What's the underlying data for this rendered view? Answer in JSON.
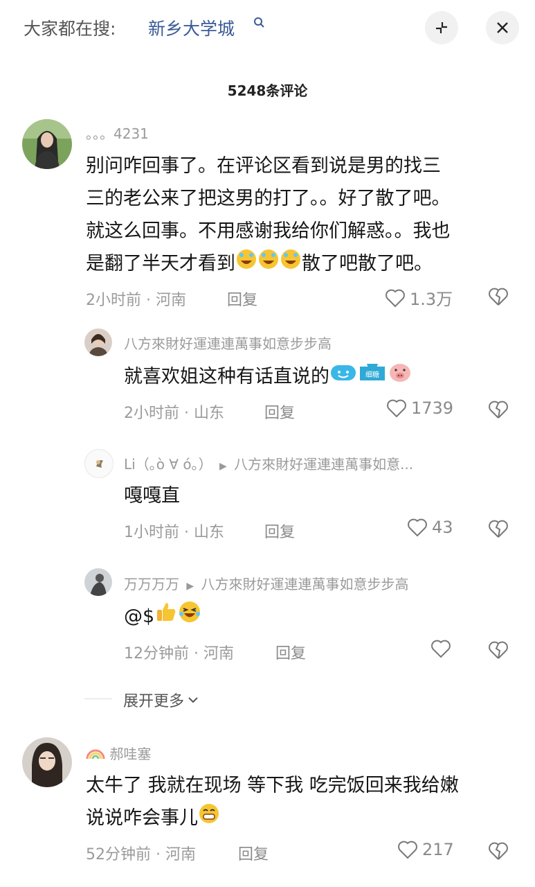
{
  "search": {
    "prefix": "大家都在搜:",
    "term": "新乡大学城"
  },
  "comment_count_title": "5248条评论",
  "comments": [
    {
      "username": "。。。4231",
      "text_lines": [
        "别问咋回事了。在评论区看到说是男的找三",
        "三的老公来了把这男的打了。。好了散了吧。",
        "就这么回事。不用感谢我给你们解惑。。我也",
        "是翻了半天才看到",
        "散了吧散了吧。"
      ],
      "time": "2小时前",
      "location": "河南",
      "reply_label": "回复",
      "likes": "1.3万"
    },
    {
      "username": "八方來財好運連連萬事如意步步高",
      "text": "就喜欢姐这种有话直说的",
      "time": "2小时前",
      "location": "山东",
      "reply_label": "回复",
      "likes": "1739"
    },
    {
      "username": "Li（｡ò ∀ ó｡）",
      "reply_to": "八方來財好運連連萬事如意...",
      "text": "嘎嘎直",
      "time": "1小时前",
      "location": "山东",
      "reply_label": "回复",
      "likes": "43"
    },
    {
      "username": "万万万万",
      "reply_to": "八方來財好運連連萬事如意步步高",
      "text": "@$",
      "time": "12分钟前",
      "location": "河南",
      "reply_label": "回复",
      "likes": ""
    },
    {
      "username": "郝哇塞",
      "text_lines": [
        "太牛了 我就在现场  等下我 吃完饭回来我给嫩",
        "说说咋会事儿"
      ],
      "time": "52分钟前",
      "location": "河南",
      "reply_label": "回复",
      "likes": "217"
    }
  ],
  "expand_more_label": "展开更多",
  "sticker_label": "细糖",
  "separator": "·"
}
